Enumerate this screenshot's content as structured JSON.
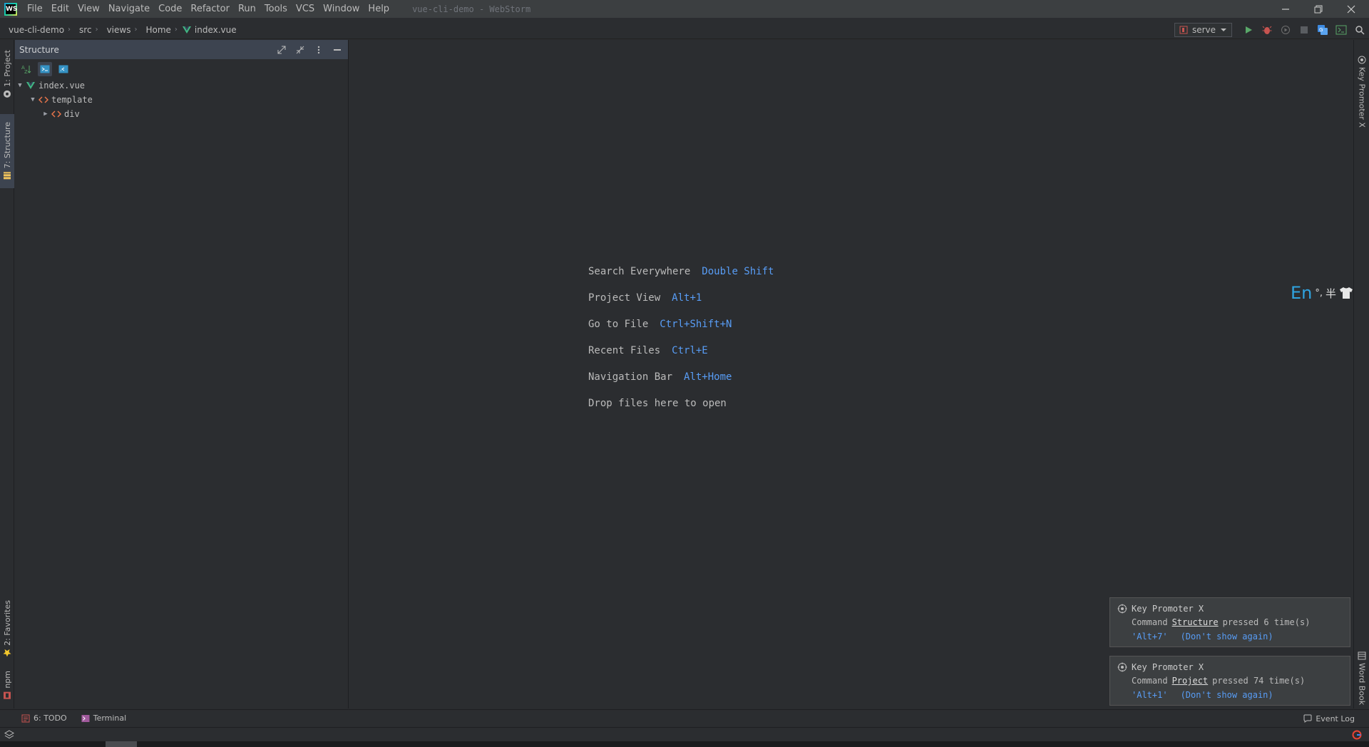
{
  "app": {
    "logo_text": "WS",
    "window_title": "vue-cli-demo - WebStorm"
  },
  "menu": [
    {
      "label": "File",
      "mnemonic": "F"
    },
    {
      "label": "Edit",
      "mnemonic": "E"
    },
    {
      "label": "View",
      "mnemonic": "V"
    },
    {
      "label": "Navigate",
      "mnemonic": "N"
    },
    {
      "label": "Code",
      "mnemonic": "C"
    },
    {
      "label": "Refactor",
      "mnemonic": "R"
    },
    {
      "label": "Run",
      "mnemonic": "u"
    },
    {
      "label": "Tools",
      "mnemonic": "T"
    },
    {
      "label": "VCS",
      "mnemonic": "S"
    },
    {
      "label": "Window",
      "mnemonic": "W"
    },
    {
      "label": "Help",
      "mnemonic": "H"
    }
  ],
  "breadcrumb": {
    "project": "vue-cli-demo",
    "items": [
      "src",
      "views",
      "Home"
    ],
    "file": "index.vue"
  },
  "toolbar": {
    "run_config": "serve"
  },
  "left_stripe": {
    "project": "1: Project",
    "structure": "7: Structure",
    "favorites": "2: Favorites",
    "npm": "npm"
  },
  "right_stripe": {
    "key_promoter": "Key Promoter X",
    "word_book": "Word Book"
  },
  "structure": {
    "title": "Structure",
    "tree": [
      {
        "label": "index.vue",
        "level": 0,
        "expanded": true,
        "icon": "vue-icon"
      },
      {
        "label": "template",
        "level": 1,
        "expanded": true,
        "icon": "tag-icon"
      },
      {
        "label": "div",
        "level": 2,
        "expanded": false,
        "icon": "tag-icon"
      }
    ]
  },
  "editor_hints": [
    {
      "label": "Search Everywhere",
      "key": "Double Shift"
    },
    {
      "label": "Project View",
      "key": "Alt+1"
    },
    {
      "label": "Go to File",
      "key": "Ctrl+Shift+N"
    },
    {
      "label": "Recent Files",
      "key": "Ctrl+E"
    },
    {
      "label": "Navigation Bar",
      "key": "Alt+Home"
    },
    {
      "label": "Drop files here to open",
      "key": ""
    }
  ],
  "ime": {
    "lang": "En",
    "punct": "°,",
    "width": "半"
  },
  "notifications": [
    {
      "title": "Key Promoter X",
      "prefix": "Command",
      "command": "Structure",
      "suffix": "pressed 6 time(s)",
      "shortcut": "'Alt+7'",
      "dismiss": "(Don't show again)"
    },
    {
      "title": "Key Promoter X",
      "prefix": "Command",
      "command": "Project",
      "suffix": "pressed 74 time(s)",
      "shortcut": "'Alt+1'",
      "dismiss": "(Don't show again)"
    }
  ],
  "bottom_tools": {
    "todo": "6: TODO",
    "terminal": "Terminal",
    "event_log": "Event Log"
  },
  "colors": {
    "accent_blue": "#589df6",
    "background": "#2b2d30",
    "header_active": "#3d4450"
  }
}
